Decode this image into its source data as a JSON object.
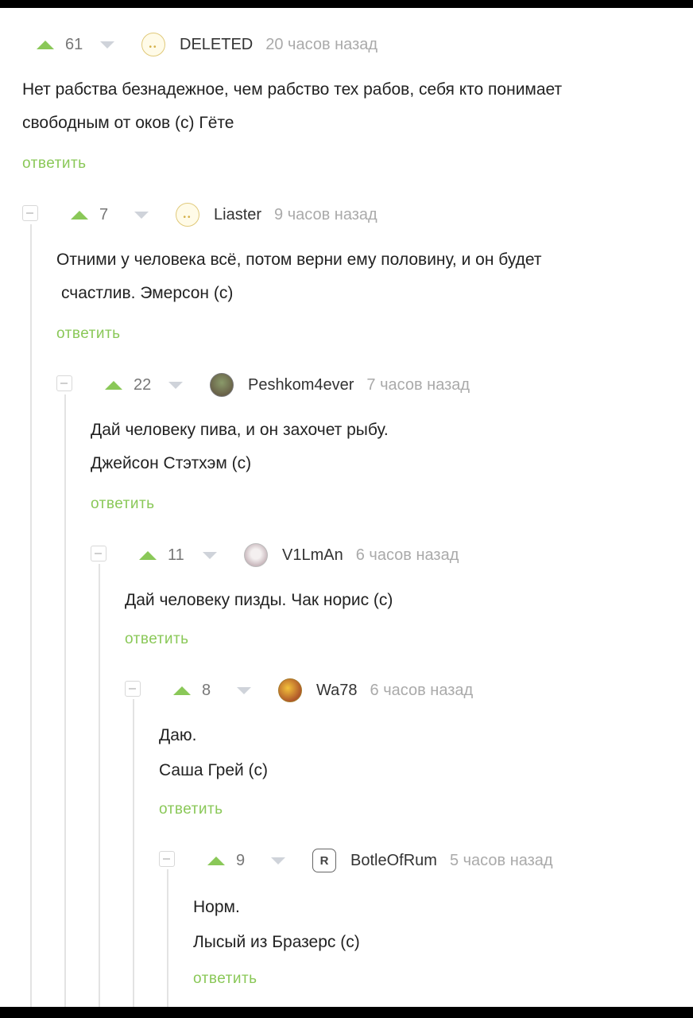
{
  "labels": {
    "reply": "ответить"
  },
  "colors": {
    "accent_green": "#8ac858",
    "muted_text": "#aaaaaa",
    "thread_line": "#e3e3e3"
  },
  "comments": [
    {
      "score": "61",
      "username": "DELETED",
      "time": "20 часов назад",
      "avatar_icon": "ghost-avatar",
      "lines": [
        "Нет рабства безнадежное, чем рабство тех рабов, себя кто понимает",
        "свободным от оков (с) Гёте"
      ]
    },
    {
      "score": "7",
      "username": "Liaster",
      "time": "9 часов назад",
      "avatar_icon": "ghost-avatar",
      "lines": [
        "Отними у человека всё, потом верни ему половину, и он будет",
        "счастлив.  Эмерсон (с)"
      ]
    },
    {
      "score": "22",
      "username": "Peshkom4ever",
      "time": "7 часов назад",
      "avatar_icon": "photo-avatar",
      "lines": [
        "Дай человеку пива, и он захочет рыбу.",
        "Джейсон Стэтхэм (с)"
      ]
    },
    {
      "score": "11",
      "username": "V1LmAn",
      "time": "6 часов назад",
      "avatar_icon": "cat-avatar",
      "lines": [
        "Дай человеку пизды. Чак норис (с)"
      ]
    },
    {
      "score": "8",
      "username": "Wa78",
      "time": "6 часов назад",
      "avatar_icon": "anime-avatar",
      "lines": [
        "Даю.",
        "Саша Грей (с)"
      ]
    },
    {
      "score": "9",
      "username": "BotleOfRum",
      "time": "5 часов назад",
      "avatar_icon": "rammstein-logo-avatar",
      "lines": [
        "Норм.",
        "Лысый из Бразерс (с)"
      ]
    }
  ]
}
